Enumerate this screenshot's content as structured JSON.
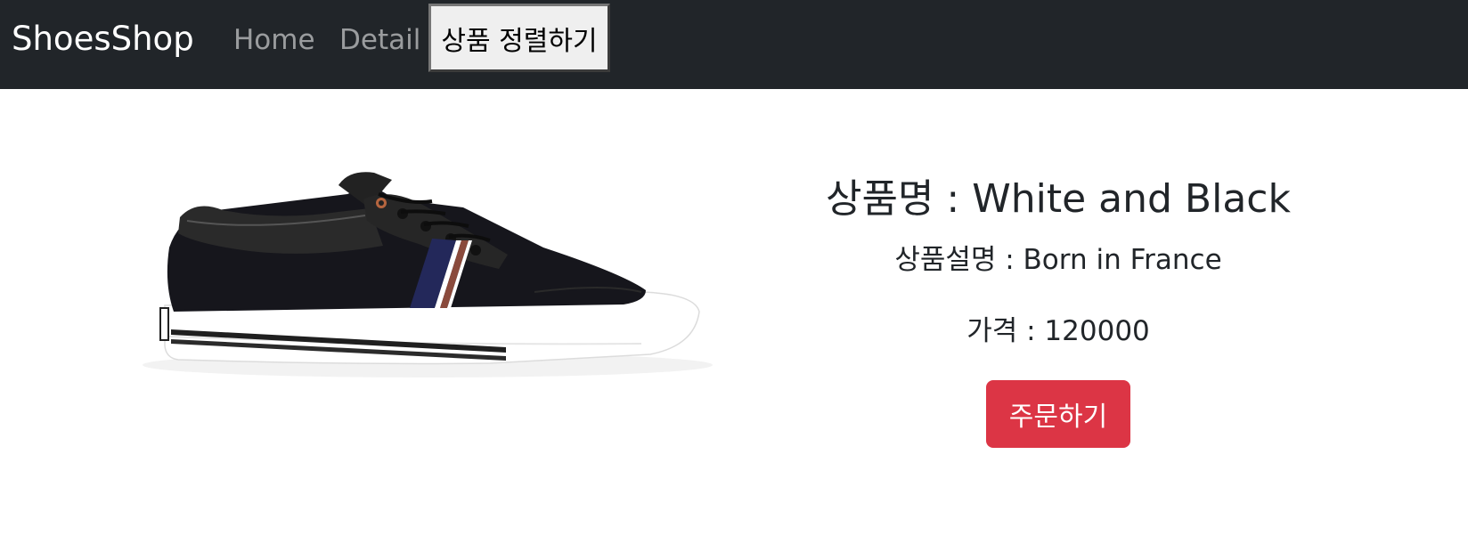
{
  "navbar": {
    "brand": "ShoesShop",
    "links": [
      {
        "label": "Home"
      },
      {
        "label": "Detail"
      }
    ],
    "sort_button_label": "상품 정렬하기",
    "background_color": "#212529"
  },
  "product": {
    "name": "상품명 : White and Black",
    "description": "상품설명 : Born in France",
    "price": "가격 : 120000",
    "image_icon": "sneaker-image"
  },
  "order_button": {
    "label": "주문하기",
    "color": "#dc3545"
  }
}
